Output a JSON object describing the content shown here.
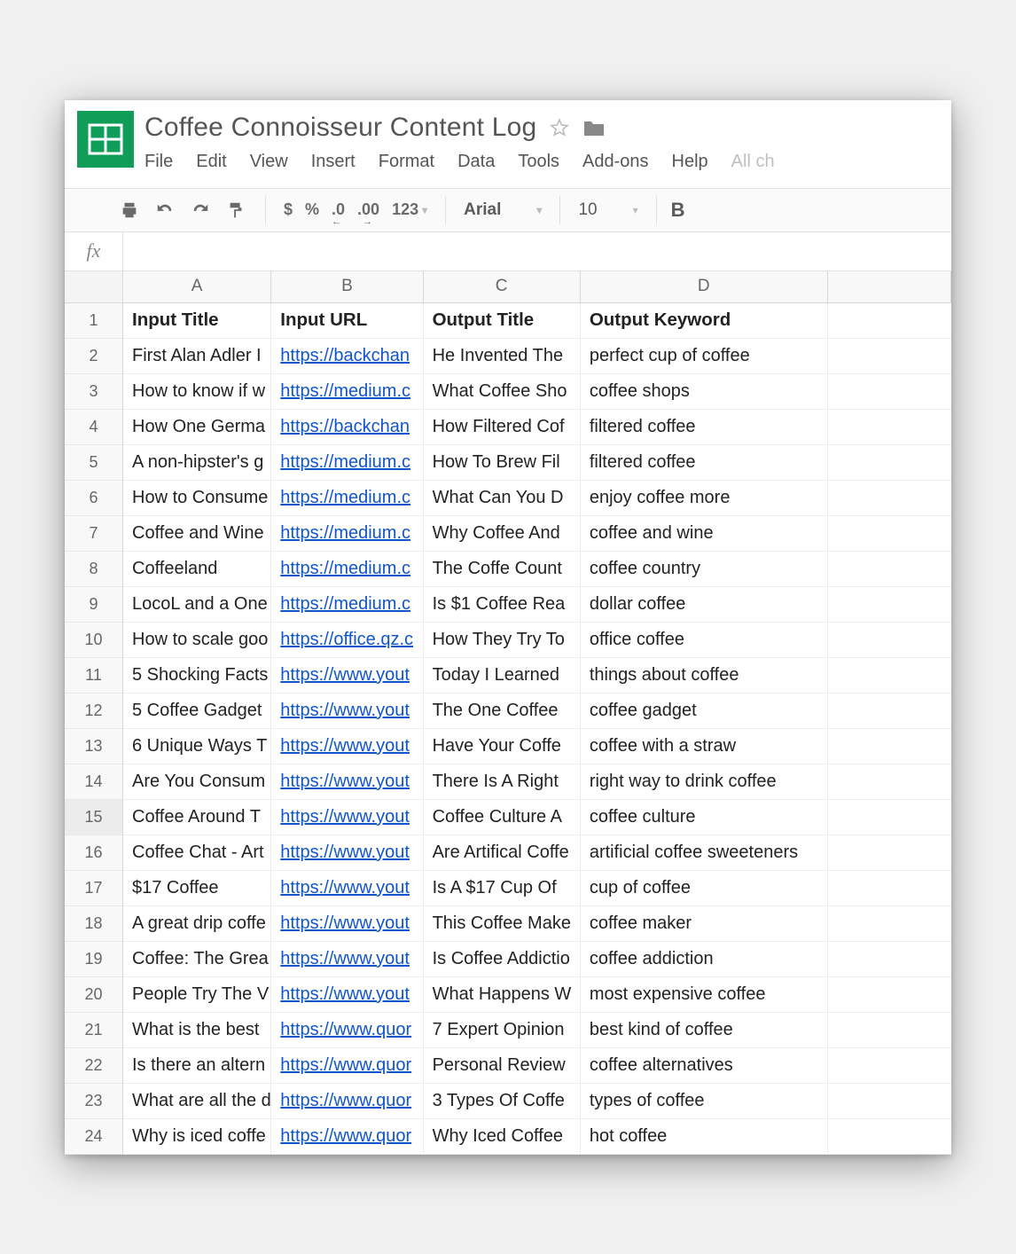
{
  "doc_title": "Coffee Connoisseur Content Log",
  "menu": [
    "File",
    "Edit",
    "View",
    "Insert",
    "Format",
    "Data",
    "Tools",
    "Add-ons",
    "Help",
    "All ch"
  ],
  "toolbar": {
    "currency": "$",
    "percent": "%",
    "dec_dec": ".0",
    "dec_inc": ".00",
    "num_format": "123",
    "font": "Arial",
    "font_size": "10",
    "bold": "B"
  },
  "fx_label": "fx",
  "columns": [
    "A",
    "B",
    "C",
    "D",
    ""
  ],
  "headers": [
    "Input Title",
    "Input URL",
    "Output Title",
    "Output Keyword"
  ],
  "rows": [
    {
      "a": "First Alan Adler I",
      "b": "https://backchan",
      "c": "He Invented The",
      "d": "perfect cup of coffee"
    },
    {
      "a": "How to know if w",
      "b": "https://medium.c",
      "c": "What Coffee Sho",
      "d": "coffee shops"
    },
    {
      "a": "How One Germa",
      "b": "https://backchan",
      "c": "How Filtered Cof",
      "d": "filtered coffee"
    },
    {
      "a": "A non-hipster's g",
      "b": "https://medium.c",
      "c": "How To Brew Fil",
      "d": "filtered coffee"
    },
    {
      "a": "How to Consume",
      "b": "https://medium.c",
      "c": "What Can You D",
      "d": "enjoy coffee more"
    },
    {
      "a": "Coffee and Wine",
      "b": "https://medium.c",
      "c": "Why Coffee And",
      "d": "coffee and wine"
    },
    {
      "a": "Coffeeland",
      "b": "https://medium.c",
      "c": "The Coffe Count",
      "d": "coffee country"
    },
    {
      "a": "LocoL and a One",
      "b": "https://medium.c",
      "c": "Is $1 Coffee Rea",
      "d": "dollar coffee"
    },
    {
      "a": "How to scale goo",
      "b": "https://office.qz.c",
      "c": "How They Try To",
      "d": "office coffee"
    },
    {
      "a": "5 Shocking Facts",
      "b": "https://www.yout",
      "c": "Today I Learned",
      "d": "things about coffee"
    },
    {
      "a": "5 Coffee Gadget",
      "b": "https://www.yout",
      "c": "The One Coffee",
      "d": "coffee gadget"
    },
    {
      "a": "6 Unique Ways T",
      "b": "https://www.yout",
      "c": "Have Your Coffe",
      "d": "coffee with a straw"
    },
    {
      "a": "Are You Consum",
      "b": "https://www.yout",
      "c": "There Is A Right",
      "d": "right way to drink coffee"
    },
    {
      "a": "Coffee Around T",
      "b": "https://www.yout",
      "c": "Coffee Culture A",
      "d": "coffee culture"
    },
    {
      "a": "Coffee Chat - Art",
      "b": "https://www.yout",
      "c": "Are Artifical Coffe",
      "d": "artificial coffee sweeteners"
    },
    {
      "a": "$17 Coffee",
      "b": "https://www.yout",
      "c": "Is A $17 Cup Of",
      "d": "cup of coffee"
    },
    {
      "a": "A great drip coffe",
      "b": "https://www.yout",
      "c": "This Coffee Make",
      "d": "coffee maker"
    },
    {
      "a": "Coffee: The Grea",
      "b": "https://www.yout",
      "c": "Is Coffee Addictio",
      "d": "coffee addiction"
    },
    {
      "a": "People Try The V",
      "b": "https://www.yout",
      "c": "What Happens W",
      "d": "most expensive coffee"
    },
    {
      "a": "What is the best",
      "b": "https://www.quor",
      "c": "7 Expert Opinion",
      "d": "best kind of coffee"
    },
    {
      "a": "Is there an altern",
      "b": "https://www.quor",
      "c": "Personal Review",
      "d": "coffee alternatives"
    },
    {
      "a": "What are all the d",
      "b": "https://www.quor",
      "c": "3 Types Of Coffe",
      "d": "types of coffee"
    },
    {
      "a": "Why is iced coffe",
      "b": "https://www.quor",
      "c": "Why Iced Coffee",
      "d": "hot coffee"
    }
  ],
  "selected_row_index": 15
}
